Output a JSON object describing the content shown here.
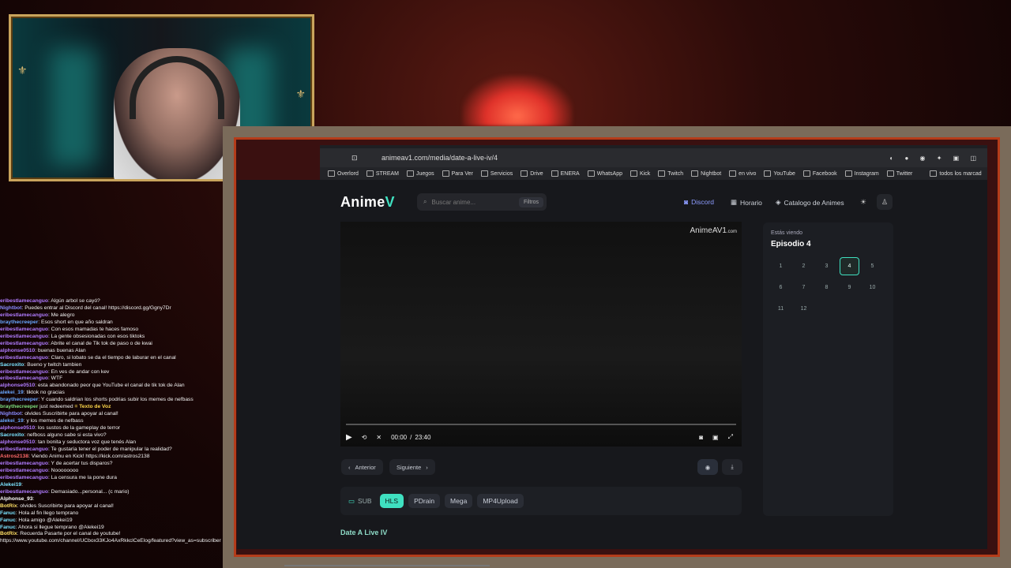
{
  "browser": {
    "url": "animeav1.com/media/date-a-live-iv/4",
    "bookmarks": [
      "Overlord",
      "STREAM",
      "Juegos",
      "Para Ver",
      "Servicios",
      "Drive",
      "ENERA",
      "WhatsApp",
      "Kick",
      "Twitch",
      "Nightbot",
      "en vivo",
      "YouTube",
      "Facebook",
      "Instagram",
      "Twitter",
      "todos los marcad"
    ]
  },
  "site": {
    "logo_text": "Anime",
    "logo_mark": "V",
    "search_placeholder": "Buscar anime...",
    "filters_label": "Filtros",
    "nav": {
      "discord": "Discord",
      "schedule": "Horario",
      "catalog": "Catalogo de Animes"
    },
    "player": {
      "watermark": "AnimeAV1",
      "watermark_suffix": ".com",
      "time_current": "00:00",
      "time_sep": "/",
      "time_total": "23:40",
      "progress": 0
    },
    "prev_label": "Anterior",
    "next_label": "Siguiente",
    "servers": {
      "sub_label": "SUB",
      "items": [
        "HLS",
        "PDrain",
        "Mega",
        "MP4Upload"
      ],
      "active": "HLS"
    },
    "anime_title": "Date A Live IV",
    "panel": {
      "watching_label": "Estás viendo",
      "current_episode": "Episodio 4",
      "episodes": [
        "1",
        "2",
        "3",
        "4",
        "5",
        "6",
        "7",
        "8",
        "9",
        "10",
        "11",
        "12"
      ],
      "active_episode": "4"
    }
  },
  "chat": [
    {
      "user": "eribestlamecanguo",
      "color": "#b17cff",
      "text": "Algún arbol se cayó?"
    },
    {
      "user": "Nightbot",
      "color": "#8a8aff",
      "text": "Puedes entrar al Discord del canal! https://discord.gg/Ggny7Dr"
    },
    {
      "user": "eribestlamecanguo",
      "color": "#b17cff",
      "text": "Me alegro"
    },
    {
      "user": "braythecreeper",
      "color": "#6aa7ff",
      "text": "Esos short en que año saldran"
    },
    {
      "user": "eribestlamecanguo",
      "color": "#b17cff",
      "text": "Con esos mamadas te haces famoso"
    },
    {
      "user": "eribestlamecanguo",
      "color": "#b17cff",
      "text": "La gente obsesionadas con esos tiktoks"
    },
    {
      "user": "eribestlamecanguo",
      "color": "#b17cff",
      "text": "Abrite el canal de Tik tok de paso o de kwai"
    },
    {
      "user": "alphonse0510",
      "color": "#b17cff",
      "text": "buenas buenas Alan"
    },
    {
      "user": "eribestlamecanguo",
      "color": "#b17cff",
      "text": "Claro, si lobato se da el tiempo de laburar en el canal"
    },
    {
      "user": "Sacroxito",
      "color": "#7be3ff",
      "text": "Bueno y twitch tambien"
    },
    {
      "user": "eribestlamecanguo",
      "color": "#b17cff",
      "text": "En ves de andar con kev"
    },
    {
      "user": "eribestlamecanguo",
      "color": "#b17cff",
      "text": "WTF"
    },
    {
      "user": "alphonse0510",
      "color": "#b17cff",
      "text": "esta abandonado peor que YouTube el canal de tik tok de Alan"
    },
    {
      "user": "alekei_19",
      "color": "#6aa7ff",
      "text": "tiktok no gracias"
    },
    {
      "user": "braythecreeper",
      "color": "#6aa7ff",
      "text": "Y cuando saldrian los shorts podrias subir los memes de nefbass"
    },
    {
      "user": "braythecreeper",
      "color": "#7ee07e",
      "text": "just redeemed",
      "reward": "Texto de Voz"
    },
    {
      "user": "Nightbot",
      "color": "#8a8aff",
      "text": "olvides Suscribirte para apoyar al canal!"
    },
    {
      "user": "alekei_19",
      "color": "#6aa7ff",
      "text": "y los memes de nefbass"
    },
    {
      "user": "alphonse0510",
      "color": "#b17cff",
      "text": "los sustos de la gameplay de terror"
    },
    {
      "user": "Sacroxito",
      "color": "#7be3ff",
      "text": "nefboss alguno sabe si esta vivo?"
    },
    {
      "user": "alphonse0510",
      "color": "#b17cff",
      "text": "tan bonita y seductora voz que tenés Alan"
    },
    {
      "user": "eribestlamecanguo",
      "color": "#b17cff",
      "text": "Te gustaría tener el poder de manipular la realidad?"
    },
    {
      "user": "Astros2138",
      "color": "#ff6a6a",
      "text": "Viendo Animu en Kick! https://kick.com/astros2138"
    },
    {
      "user": "eribestlamecanguo",
      "color": "#b17cff",
      "text": "Y de acertar tus disparos?"
    },
    {
      "user": "eribestlamecanguo",
      "color": "#b17cff",
      "text": "Noooooooo"
    },
    {
      "user": "eribestlamecanguo",
      "color": "#b17cff",
      "text": "La censura me la pone dura"
    },
    {
      "user": "Alekei19",
      "color": "#7be3ff",
      "text": ""
    },
    {
      "user": "eribestlamecanguo",
      "color": "#b17cff",
      "text": "Demasiado...personal... (c mario)"
    },
    {
      "user": "Alphonse_93",
      "color": "#ffffff",
      "text": ""
    },
    {
      "user": "BotRix",
      "color": "#ffe066",
      "text": "olvides Suscribirte para apoyar al canal!"
    },
    {
      "user": "Fanuc",
      "color": "#7be3ff",
      "text": "Hola al fin llego temprano"
    },
    {
      "user": "Fanuc",
      "color": "#7be3ff",
      "text": "Hola amigo @Alekei19"
    },
    {
      "user": "Fanuc",
      "color": "#7be3ff",
      "text": "Ahora si llegue temprano @Alekei19"
    },
    {
      "user": "BotRix",
      "color": "#ffe066",
      "text": "Recuerda Pasarte por el canal de youtube! https://www.youtube.com/channel/UCbox33KJo4AxRkkclCeElog/featured?view_as=subscriber"
    }
  ],
  "colors": {
    "accent": "#3fe0c0",
    "discord": "#8d9cff",
    "frame": "#c9a45c"
  }
}
